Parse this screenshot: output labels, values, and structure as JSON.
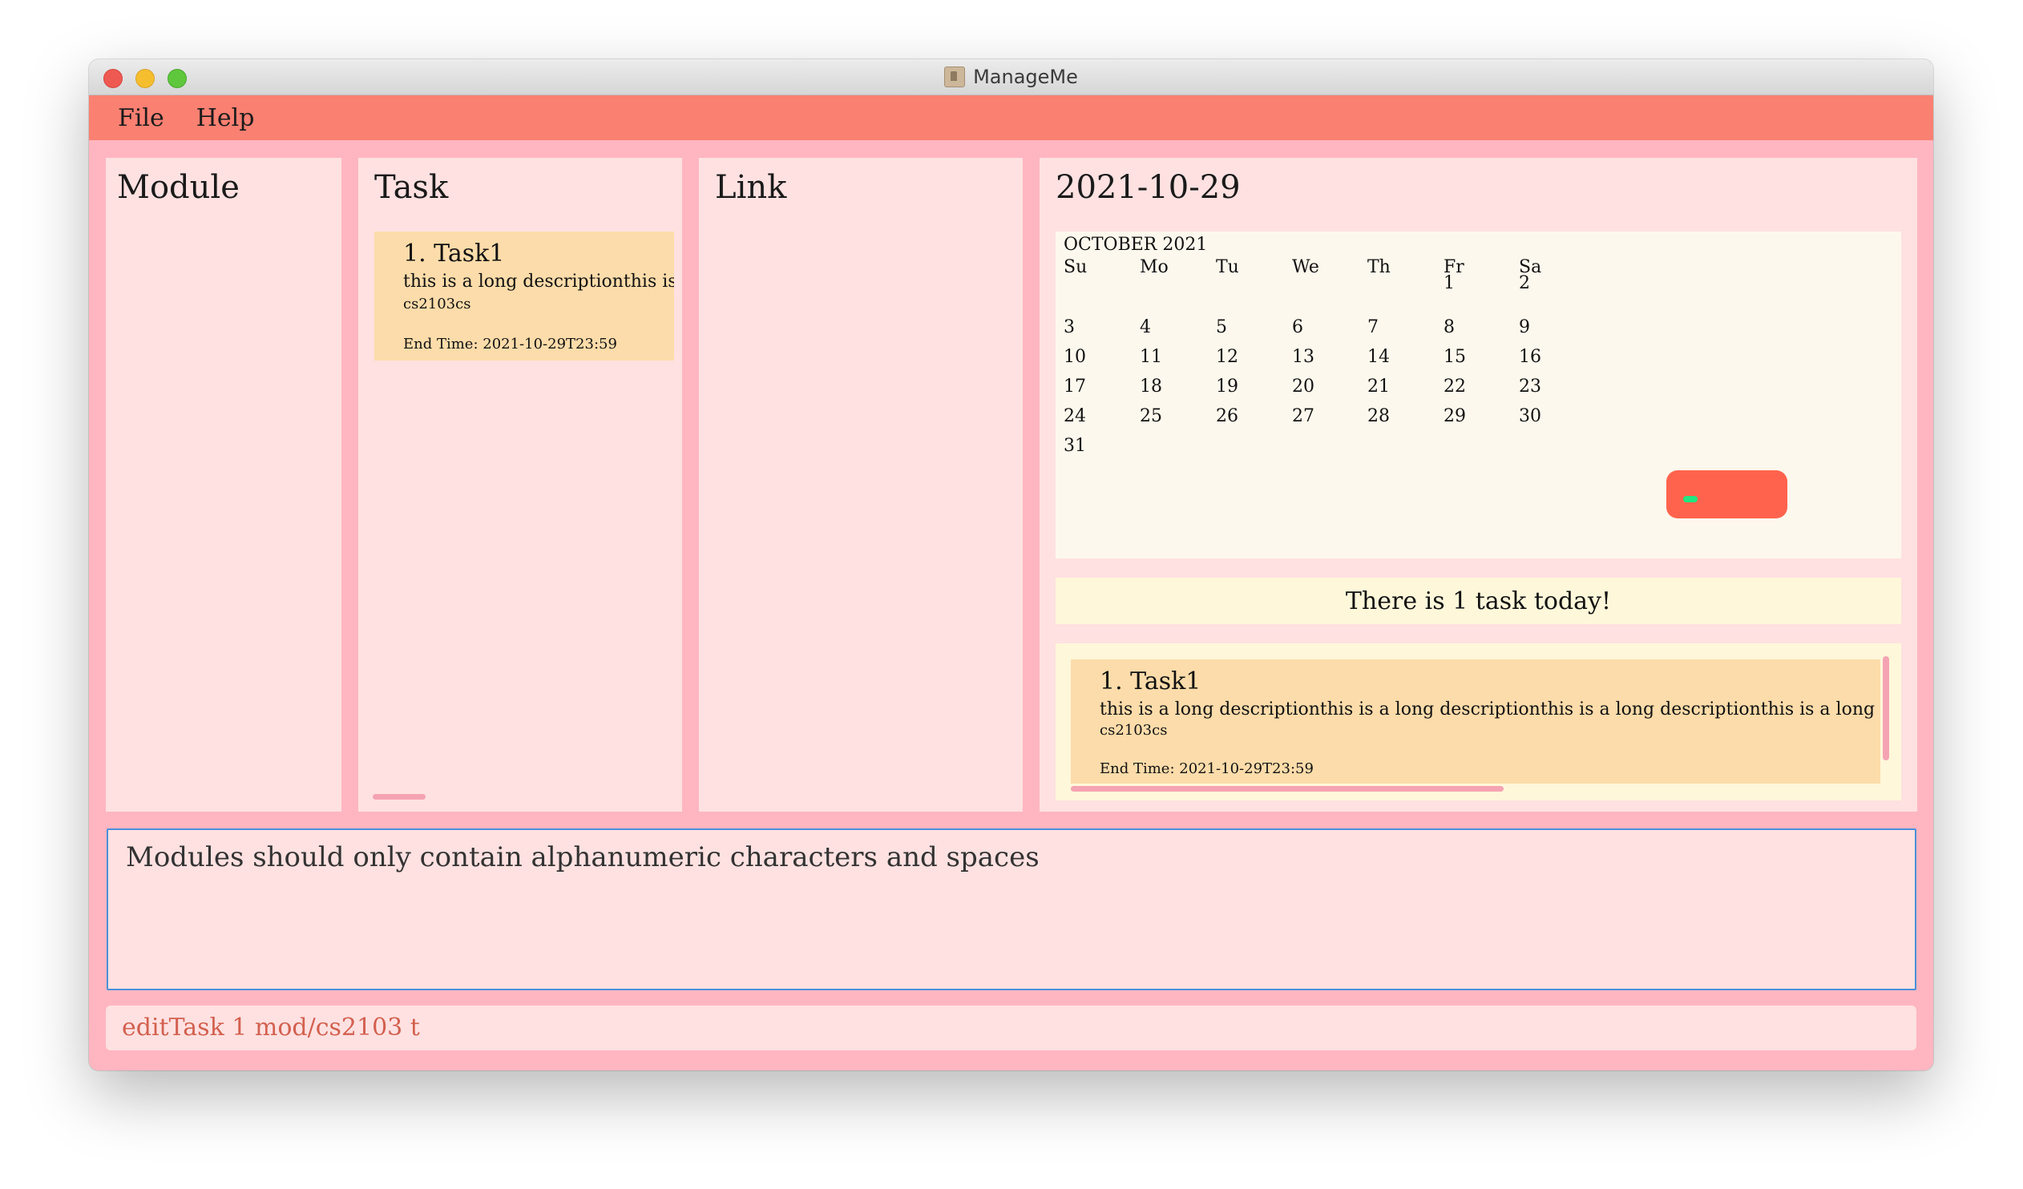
{
  "window": {
    "title": "ManageMe"
  },
  "menu": {
    "items": [
      "File",
      "Help"
    ]
  },
  "panels": {
    "module": "Module",
    "task": "Task",
    "link": "Link",
    "date": "2021-10-29"
  },
  "task_list": [
    {
      "name": "1.  Task1",
      "description": "this is a long descriptionthis is a",
      "tag": "cs2103cs",
      "end_time": "End Time: 2021-10-29T23:59"
    }
  ],
  "calendar": {
    "month_label": "OCTOBER 2021",
    "day_headers": [
      "Su",
      "Mo",
      "Tu",
      "We",
      "Th",
      "Fr",
      "Sa"
    ],
    "weeks": [
      [
        "",
        "",
        "",
        "",
        "",
        "1",
        "2"
      ],
      [
        "3",
        "4",
        "5",
        "6",
        "7",
        "8",
        "9"
      ],
      [
        "10",
        "11",
        "12",
        "13",
        "14",
        "15",
        "16"
      ],
      [
        "17",
        "18",
        "19",
        "20",
        "21",
        "22",
        "23"
      ],
      [
        "24",
        "25",
        "26",
        "27",
        "28",
        "29",
        "30"
      ],
      [
        "31",
        "",
        "",
        "",
        "",
        "",
        ""
      ]
    ],
    "selected_day": "29",
    "highlight_color": "#ff634d"
  },
  "summary": "There is 1 task today!",
  "today_tasks": [
    {
      "name": "1.  Task1",
      "description": "this is a long descriptionthis is a long descriptionthis is a long descriptionthis is a long descri",
      "tag": "cs2103cs",
      "end_time": "End Time: 2021-10-29T23:59"
    }
  ],
  "result_message": "Modules should only contain alphanumeric characters and spaces",
  "command_input": "editTask 1 mod/cs2103 t",
  "colors": {
    "menubar": "#fa8072",
    "background": "#ffb6c1",
    "panel": "#ffe1e1",
    "card": "#fcdcaa"
  }
}
